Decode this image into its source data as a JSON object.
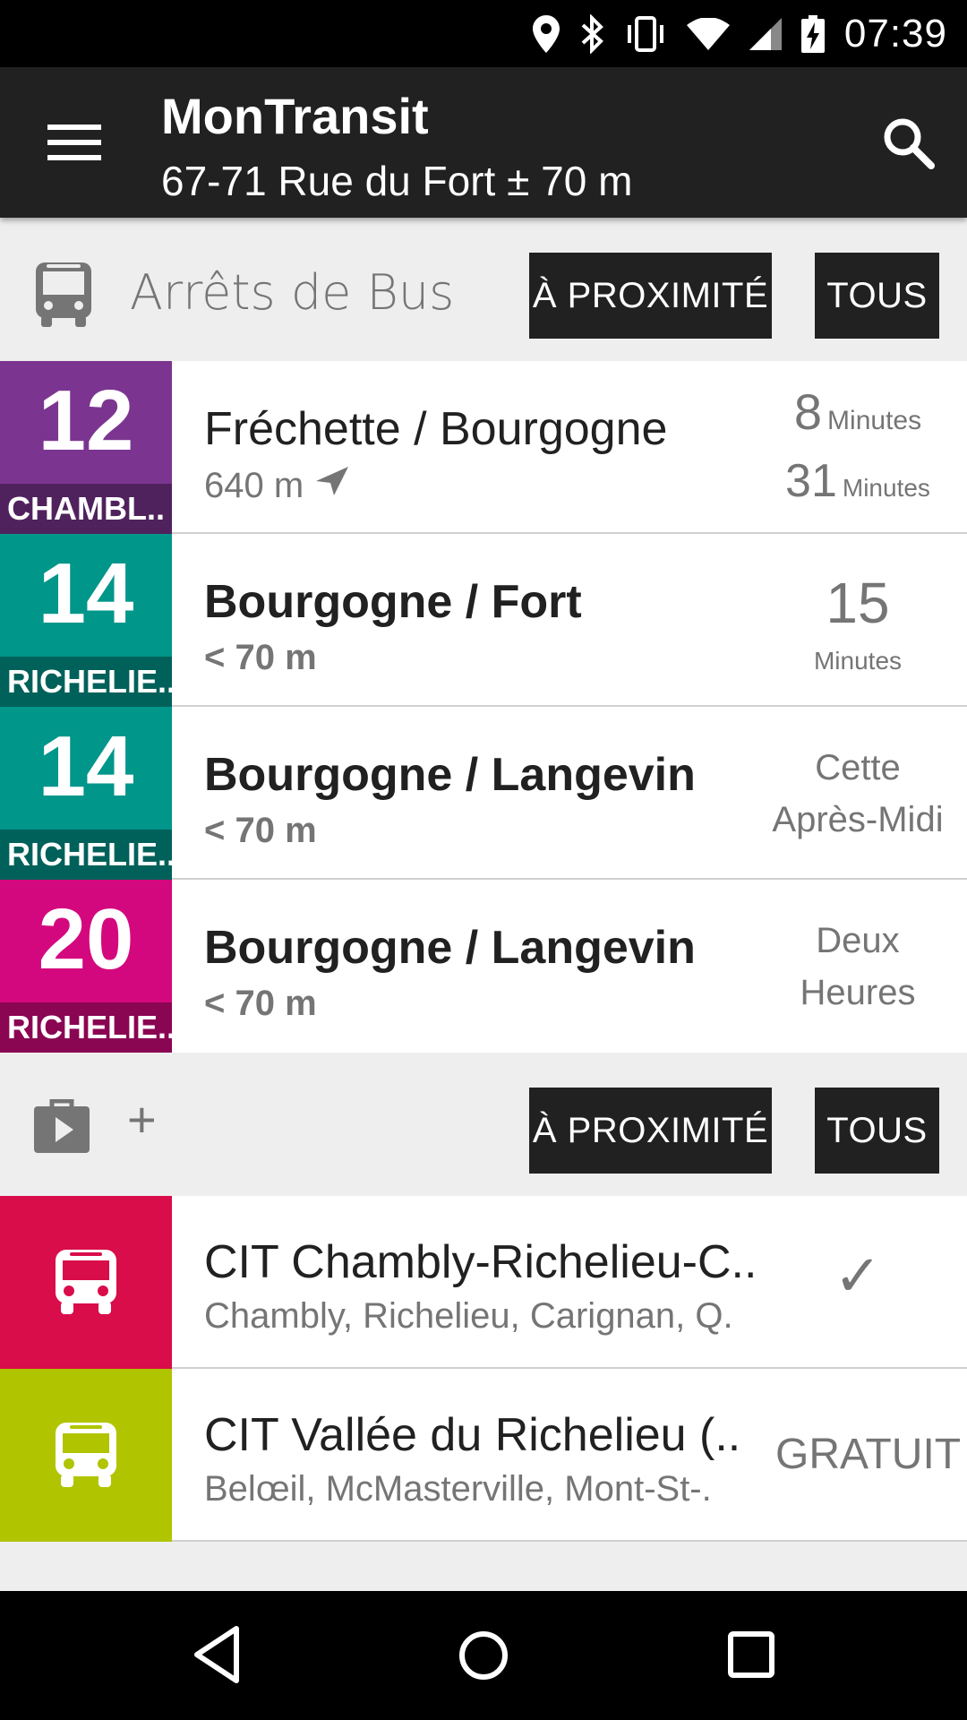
{
  "status_bar": {
    "time": "07:39",
    "icons": [
      "location-icon",
      "bluetooth-icon",
      "vibrate-icon",
      "wifi-icon",
      "signal-icon",
      "battery-charging-icon"
    ]
  },
  "toolbar": {
    "title": "MonTransit",
    "subtitle": "67-71 Rue du Fort ± 70 m"
  },
  "bus_section": {
    "label": "Arrêts de Bus",
    "nearby_button": "À PROXIMITÉ",
    "all_button": "TOUS",
    "stops": [
      {
        "route": "12",
        "route_name": "CHAMBL..",
        "color": "#7b3590",
        "stop_name": "Fréchette / Bourgogne",
        "distance": "640 m",
        "times": [
          {
            "value": "8",
            "unit": "Minutes"
          },
          {
            "value": "31",
            "unit": "Minutes"
          }
        ]
      },
      {
        "route": "14",
        "route_name": "RICHELIE..",
        "color": "#00968a",
        "stop_name": "Bourgogne / Fort",
        "distance": "< 70 m",
        "time_value": "15",
        "time_unit": "Minutes"
      },
      {
        "route": "14",
        "route_name": "RICHELIE..",
        "color": "#00968a",
        "stop_name": "Bourgogne / Langevin",
        "distance": "< 70 m",
        "time_line1": "Cette",
        "time_line2": "Après-Midi"
      },
      {
        "route": "20",
        "route_name": "RICHELIE..",
        "color": "#d4087e",
        "stop_name": "Bourgogne / Langevin",
        "distance": "< 70 m",
        "time_line1": "Deux",
        "time_line2": "Heures"
      }
    ]
  },
  "agency_section": {
    "plus": "+",
    "nearby_button": "À PROXIMITÉ",
    "all_button": "TOUS",
    "agencies": [
      {
        "name": "CIT Chambly-Richelieu-C..",
        "area": "Chambly, Richelieu, Carignan, Q.",
        "color": "#d80d4a",
        "status": "✓"
      },
      {
        "name": "CIT Vallée du Richelieu (..",
        "area": "Belœil, McMasterville, Mont-St-.",
        "color": "#b0c500",
        "status": "GRATUIT"
      }
    ]
  }
}
